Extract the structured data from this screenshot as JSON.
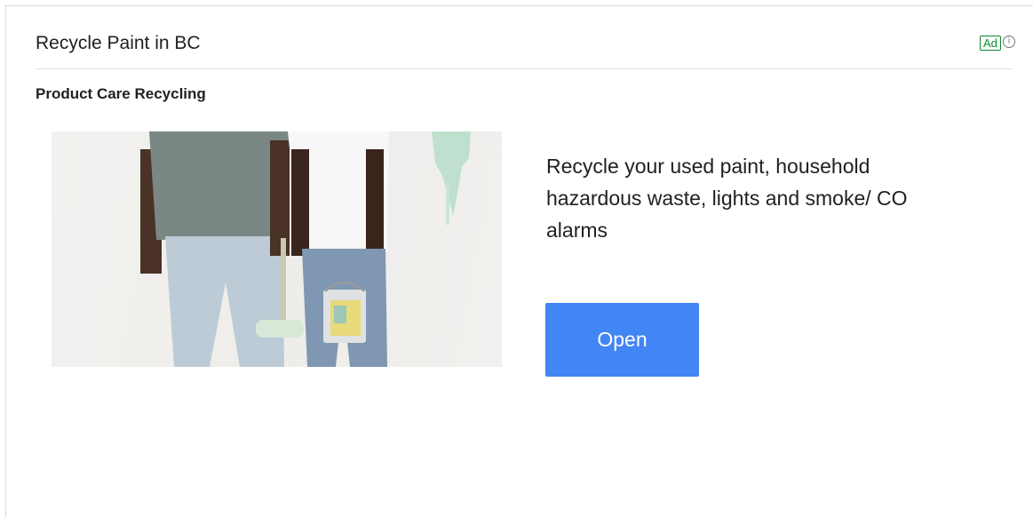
{
  "ad": {
    "headline": "Recycle Paint in BC",
    "badge": "Ad",
    "info_glyph": "i",
    "advertiser": "Product Care Recycling",
    "description": "Recycle your used paint, household hazardous waste, lights and smoke/ CO alarms",
    "cta_label": "Open"
  },
  "colors": {
    "cta_background": "#4285f4",
    "badge_green": "#0a8a2e",
    "divider": "#dadce0"
  },
  "icons": {
    "info": "info-circle-icon"
  }
}
